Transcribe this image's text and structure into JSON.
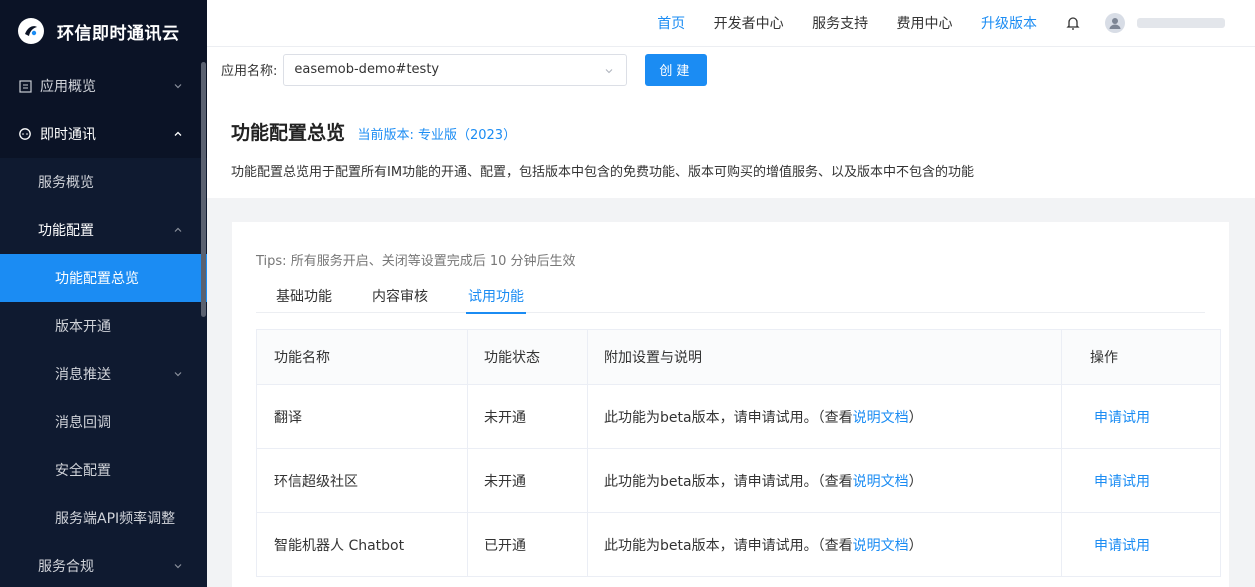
{
  "brand": {
    "name": "环信即时通讯云"
  },
  "sidebar": {
    "items": [
      {
        "label": "应用概览",
        "level": 1
      },
      {
        "label": "即时通讯",
        "level": 1
      },
      {
        "label": "服务概览",
        "level": 2
      },
      {
        "label": "功能配置",
        "level": 2
      },
      {
        "label": "功能配置总览",
        "level": 3,
        "active": true
      },
      {
        "label": "版本开通",
        "level": 3
      },
      {
        "label": "消息推送",
        "level": 3
      },
      {
        "label": "消息回调",
        "level": 3
      },
      {
        "label": "安全配置",
        "level": 3
      },
      {
        "label": "服务端API频率调整",
        "level": 3
      },
      {
        "label": "服务合规",
        "level": 2
      }
    ]
  },
  "topnav": {
    "home": "首页",
    "developer": "开发者中心",
    "support": "服务支持",
    "billing": "费用中心",
    "upgrade": "升级版本"
  },
  "app_selector": {
    "label": "应用名称:",
    "value": "easemob-demo#testy",
    "create_label": "创建"
  },
  "header": {
    "title": "功能配置总览",
    "version": "当前版本: 专业版（2023）",
    "description": "功能配置总览用于配置所有IM功能的开通、配置，包括版本中包含的免费功能、版本可购买的增值服务、以及版本中不包含的功能"
  },
  "main": {
    "tips": "Tips: 所有服务开启、关闭等设置完成后 10 分钟后生效",
    "tabs": [
      {
        "label": "基础功能",
        "active": false
      },
      {
        "label": "内容审核",
        "active": false
      },
      {
        "label": "试用功能",
        "active": true
      }
    ],
    "table": {
      "headers": [
        "功能名称",
        "功能状态",
        "附加设置与说明",
        "操作"
      ],
      "rows": [
        {
          "name": "翻译",
          "status": "未开通",
          "note": "此功能为beta版本，请申请试用。（查看",
          "doc_link": "说明文档",
          "note_end": "）",
          "action": "申请试用"
        },
        {
          "name": "环信超级社区",
          "status": "未开通",
          "note": "此功能为beta版本，请申请试用。（查看",
          "doc_link": "说明文档",
          "note_end": "）",
          "action": "申请试用"
        },
        {
          "name": "智能机器人 Chatbot",
          "status": "已开通",
          "note": "此功能为beta版本，请申请试用。（查看",
          "doc_link": "说明文档",
          "note_end": "）",
          "action": "申请试用"
        }
      ]
    }
  },
  "colors": {
    "accent": "#1b8cf3",
    "sidebar_bg": "#0b1326"
  }
}
